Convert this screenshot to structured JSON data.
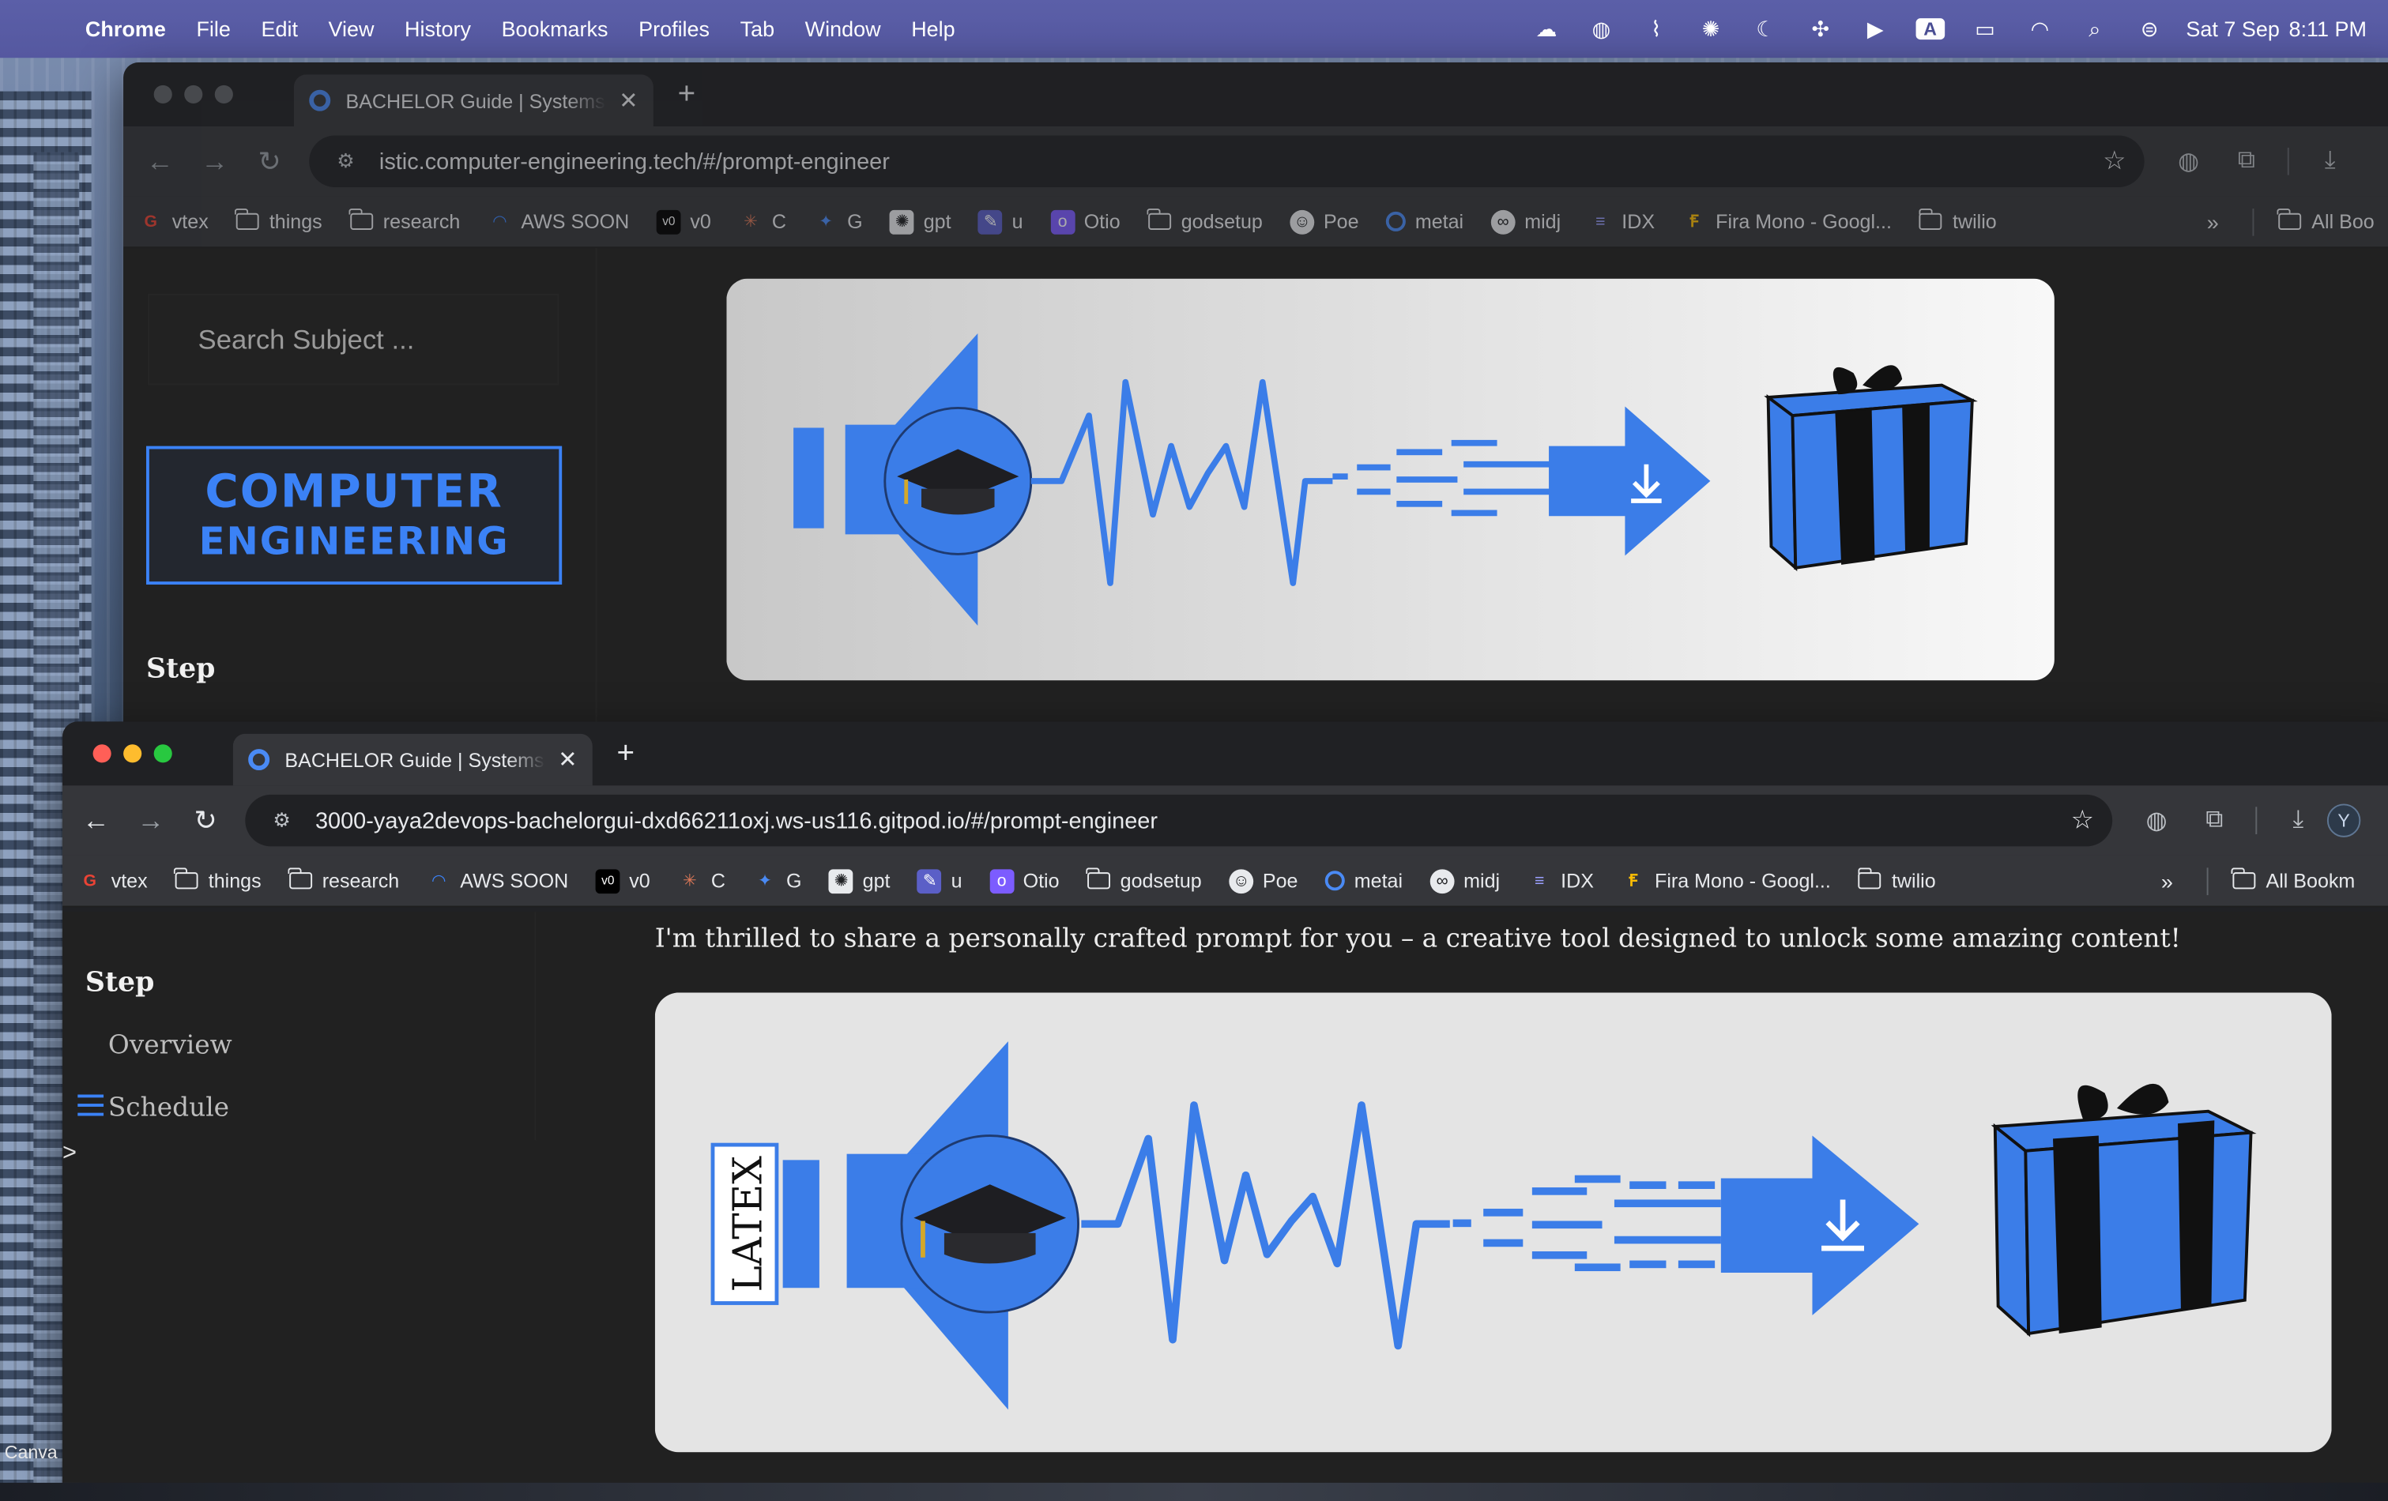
{
  "menubar": {
    "app_name": "Chrome",
    "menus": [
      "File",
      "Edit",
      "View",
      "History",
      "Bookmarks",
      "Profiles",
      "Tab",
      "Window",
      "Help"
    ],
    "input_source": "A",
    "date": "Sat 7 Sep",
    "time": "8:11 PM"
  },
  "back_window": {
    "tab_title": "BACHELOR Guide | Systems E",
    "url": "istic.computer-engineering.tech/#/prompt-engineer",
    "search_placeholder": "Search Subject ...",
    "logo_line1": "COMPUTER",
    "logo_line2": "ENGINEERING",
    "step_heading": "Step"
  },
  "front_window": {
    "tab_title": "BACHELOR Guide | Systems E",
    "url": "3000-yaya2devops-bachelorgui-dxd66211oxj.ws-us116.gitpod.io/#/prompt-engineer",
    "avatar_letter": "Y",
    "intro_text": "I'm thrilled to share a personally crafted prompt for you – a creative tool designed to unlock some amazing content!",
    "step_heading": "Step",
    "nav_items": [
      "Overview",
      "Schedule"
    ],
    "toggle_caret": ">"
  },
  "bookmarks": {
    "items": [
      {
        "label": "vtex",
        "icon": "google-icon"
      },
      {
        "label": "things",
        "icon": "folder-icon"
      },
      {
        "label": "research",
        "icon": "folder-icon"
      },
      {
        "label": "AWS SOON",
        "icon": "aws-icon"
      },
      {
        "label": "v0",
        "icon": "v0-icon"
      },
      {
        "label": "C",
        "icon": "claude-icon"
      },
      {
        "label": "G",
        "icon": "gemini-icon"
      },
      {
        "label": "gpt",
        "icon": "openai-icon"
      },
      {
        "label": "u",
        "icon": "app-icon"
      },
      {
        "label": "Otio",
        "icon": "otio-icon"
      },
      {
        "label": "godsetup",
        "icon": "folder-icon"
      },
      {
        "label": "Poe",
        "icon": "poe-icon"
      },
      {
        "label": "metai",
        "icon": "meta-icon"
      },
      {
        "label": "midj",
        "icon": "midjourney-icon"
      },
      {
        "label": "IDX",
        "icon": "idx-icon"
      },
      {
        "label": "Fira Mono - Googl...",
        "icon": "google-fonts-icon"
      },
      {
        "label": "twilio",
        "icon": "folder-icon"
      }
    ],
    "more_label": "»",
    "all_bookmarks_front": "All Bookm",
    "all_bookmarks_back": "All Boo"
  },
  "hero_image": {
    "latex_label": "LATEX"
  },
  "colors": {
    "accent": "#3b82f6",
    "page_bg": "#212121",
    "chrome_toolbar": "#35363a"
  },
  "dock": {
    "canva_label": "Canva"
  }
}
